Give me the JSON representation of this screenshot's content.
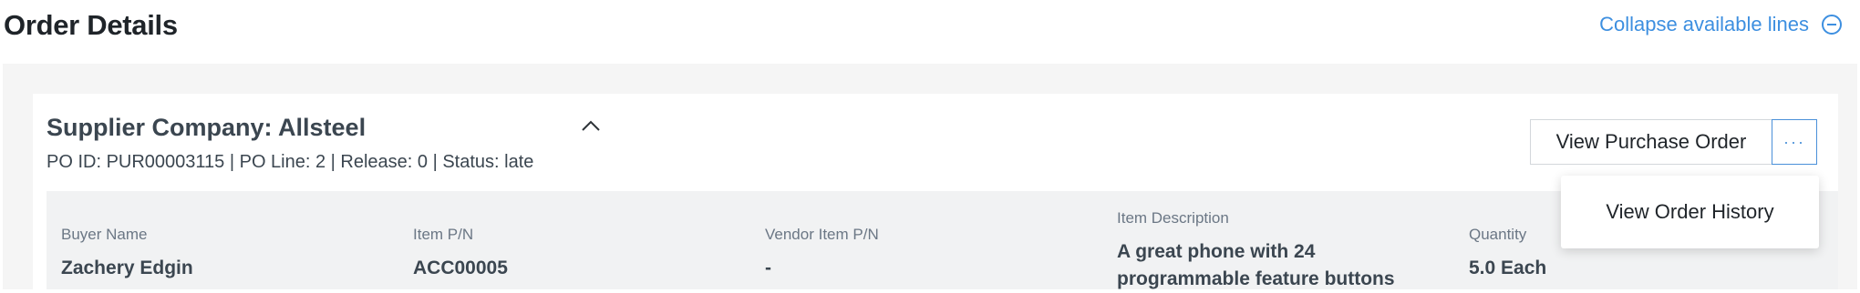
{
  "header": {
    "title": "Order Details",
    "collapse_label": "Collapse available lines"
  },
  "card": {
    "supplier_title": "Supplier Company: Allsteel",
    "po_meta": "PO ID: PUR00003115 | PO Line: 2 | Release: 0 | Status: late",
    "view_po_label": "View Purchase Order",
    "more_label": "···",
    "menu": {
      "items": [
        "View Order History"
      ]
    },
    "fields": [
      {
        "label": "Buyer Name",
        "value": "Zachery Edgin"
      },
      {
        "label": "Item P/N",
        "value": "ACC00005"
      },
      {
        "label": "Vendor Item P/N",
        "value": "-"
      },
      {
        "label": "Item Description",
        "value": "A great phone with 24 programmable feature buttons"
      },
      {
        "label": "Quantity",
        "value": "5.0 Each"
      }
    ]
  },
  "colors": {
    "accent": "#3d8fe0",
    "panel_bg": "#f5f5f5",
    "strip_bg": "#f1f2f3"
  }
}
